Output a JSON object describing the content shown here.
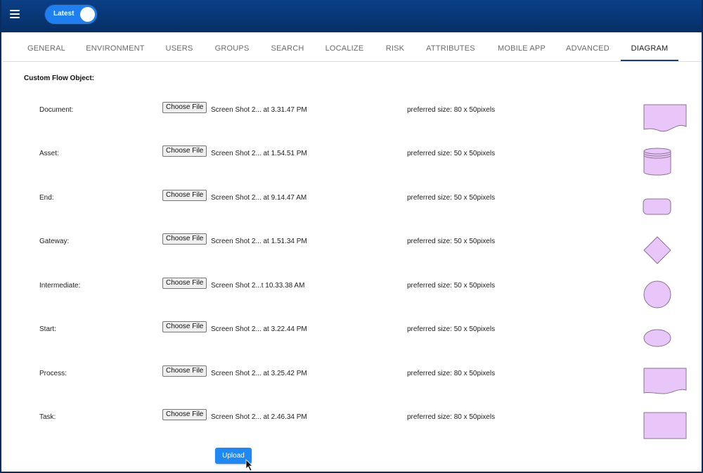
{
  "topbar": {
    "version_toggle_label": "Latest",
    "menu_icon": "hamburger-menu-icon"
  },
  "tabs": [
    {
      "label": "GENERAL",
      "active": false
    },
    {
      "label": "ENVIRONMENT",
      "active": false
    },
    {
      "label": "USERS",
      "active": false
    },
    {
      "label": "GROUPS",
      "active": false
    },
    {
      "label": "SEARCH",
      "active": false
    },
    {
      "label": "LOCALIZE",
      "active": false
    },
    {
      "label": "RISK",
      "active": false
    },
    {
      "label": "ATTRIBUTES",
      "active": false
    },
    {
      "label": "MOBILE APP",
      "active": false
    },
    {
      "label": "ADVANCED",
      "active": false
    },
    {
      "label": "DIAGRAM",
      "active": true
    }
  ],
  "section_title": "Custom Flow Object:",
  "choose_file_label": "Choose File",
  "rows": [
    {
      "label": "Document:",
      "file": "Screen Shot 2... at 3.31.47 PM",
      "size": "preferred size: 80 x 50pixels",
      "shape": "document-shape-icon"
    },
    {
      "label": "Asset:",
      "file": "Screen Shot 2... at 1.54.51 PM",
      "size": "preferred size: 50 x 50pixels",
      "shape": "cylinder-shape-icon"
    },
    {
      "label": "End:",
      "file": "Screen Shot 2... at 9.14.47 AM",
      "size": "preferred size: 50 x 50pixels",
      "shape": "rounded-rectangle-shape-icon"
    },
    {
      "label": "Gateway:",
      "file": "Screen Shot 2... at 1.51.34 PM",
      "size": "preferred size: 50 x 50pixels",
      "shape": "diamond-shape-icon"
    },
    {
      "label": "Intermediate:",
      "file": "Screen Shot 2...t 10.33.38 AM",
      "size": "preferred size: 50 x 50pixels",
      "shape": "circle-shape-icon"
    },
    {
      "label": "Start:",
      "file": "Screen Shot 2... at 3.22.44 PM",
      "size": "preferred size: 50 x 50pixels",
      "shape": "ellipse-shape-icon"
    },
    {
      "label": "Process:",
      "file": "Screen Shot 2... at 3.25.42 PM",
      "size": "preferred size: 80 x 50pixels",
      "shape": "process-shape-icon"
    },
    {
      "label": "Task:",
      "file": "Screen Shot 2... at 2.46.34 PM",
      "size": "preferred size: 80 x 50pixels",
      "shape": "rectangle-shape-icon"
    }
  ],
  "upload_label": "Upload",
  "colors": {
    "topbar": "#072f66",
    "toggle": "#1e7ff0",
    "shape_fill": "#e9c6f9",
    "shape_stroke": "#8a7391",
    "upload_button": "#1e88f5",
    "active_tab_underline": "#1c3f6e"
  }
}
